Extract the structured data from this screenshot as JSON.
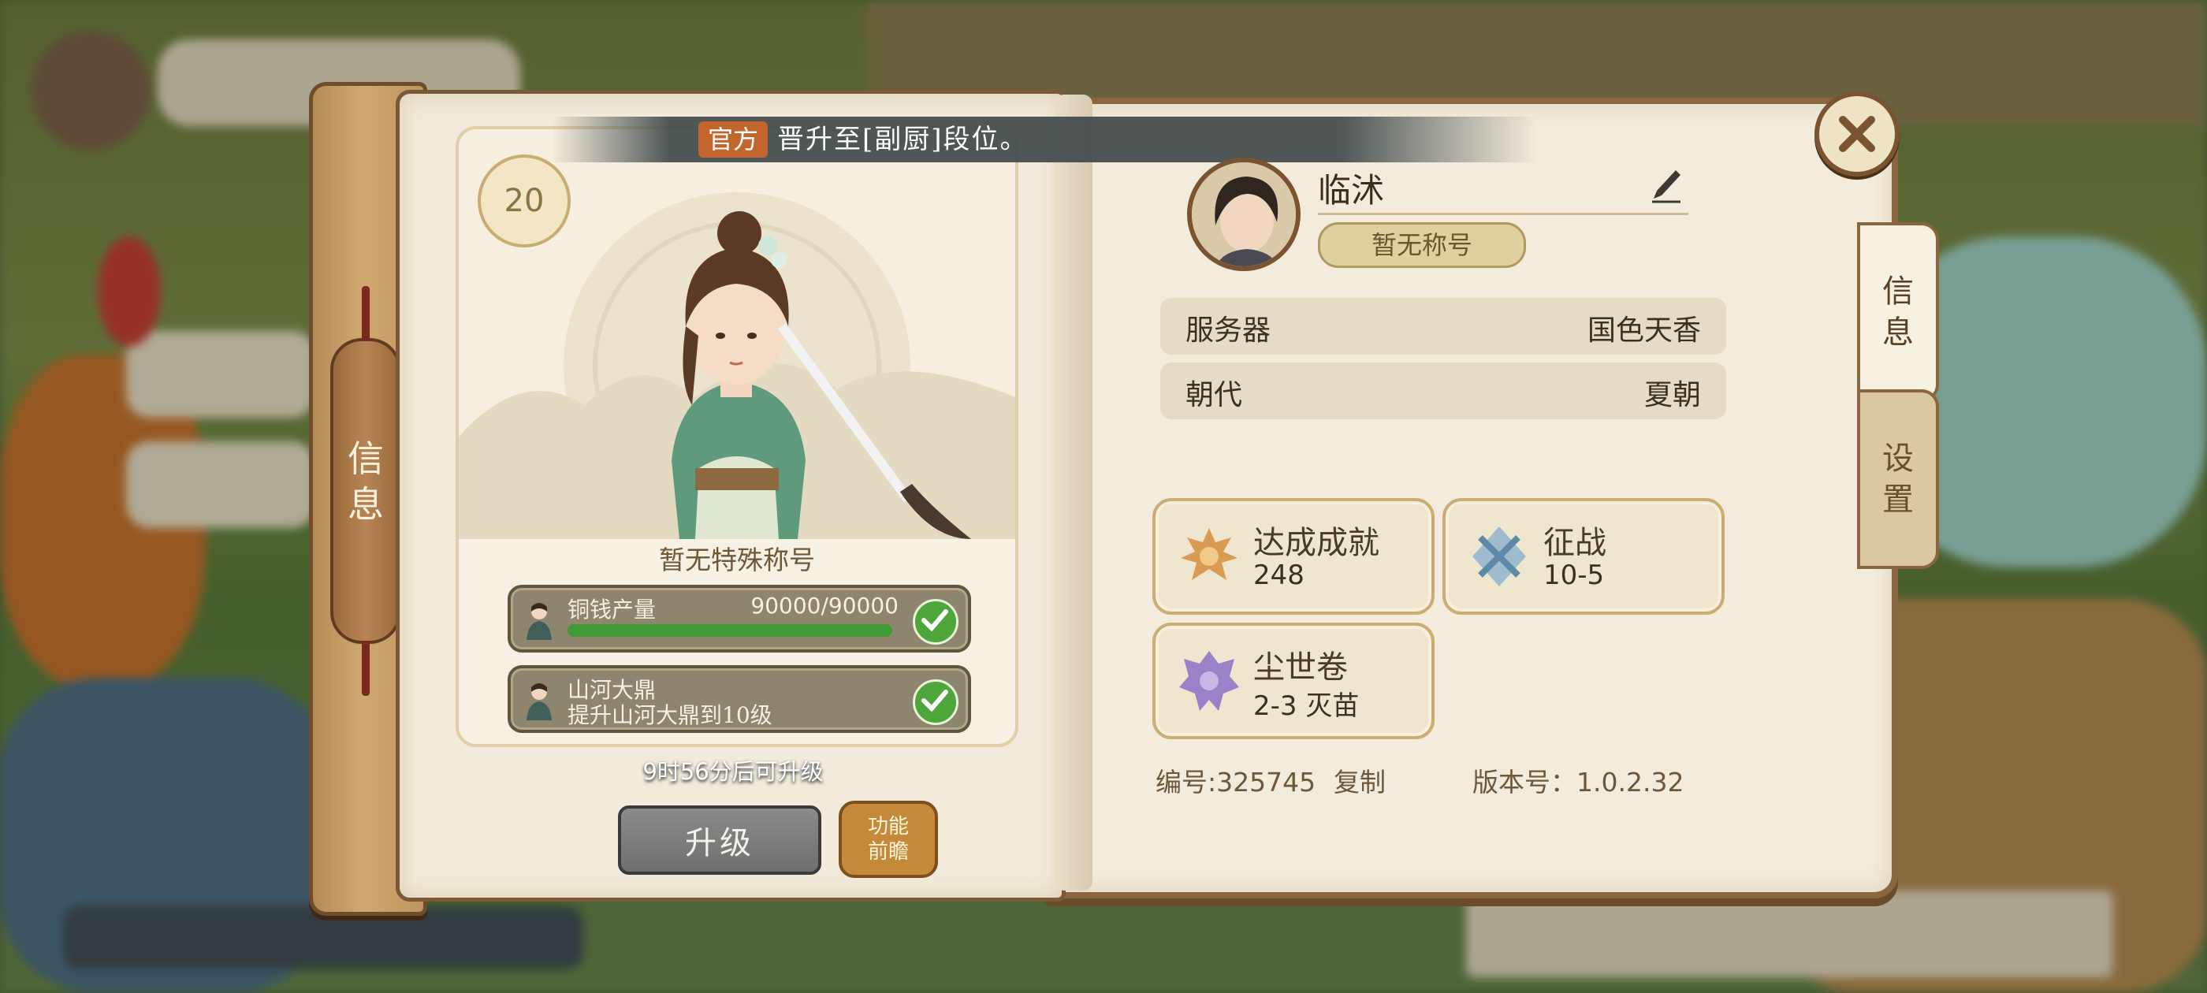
{
  "notice": {
    "tag": "官方",
    "message": "晋升至[副厨]段位。"
  },
  "spine": {
    "label": "信\n息"
  },
  "character": {
    "level": "20",
    "special_title": "暂无特殊称号",
    "tasks": [
      {
        "line1": "铜钱产量",
        "count": "90000/90000",
        "progress": 1.0,
        "done": true
      },
      {
        "line1": "山河大鼎",
        "line2": "提升山河大鼎到10级",
        "done": true
      }
    ],
    "timer": "9时56分后可升级",
    "upgrade_label": "升级",
    "feature_label": "功能\n前瞻"
  },
  "profile": {
    "name": "临沭",
    "title": "暂无称号",
    "rows": [
      {
        "key": "服务器",
        "value": "国色天香"
      },
      {
        "key": "朝代",
        "value": "夏朝"
      }
    ],
    "stats": [
      {
        "name": "达成成就",
        "value": "248",
        "icon": "phoenix-emblem-icon"
      },
      {
        "name": "征战",
        "value": "10-5",
        "icon": "crossed-swords-icon"
      },
      {
        "name": "尘世卷",
        "value": "2-3 灭苗",
        "icon": "purple-crest-icon"
      }
    ],
    "id_label": "编号:325745",
    "copy_label": "复制",
    "version_label": "版本号：1.0.2.32"
  },
  "side_tabs": [
    {
      "label": "信\n息",
      "active": true
    },
    {
      "label": "设\n置",
      "active": false
    }
  ],
  "colors": {
    "banner_tag": "#c2662d",
    "check": "#4ea53a",
    "book_border": "#7a5a36"
  }
}
